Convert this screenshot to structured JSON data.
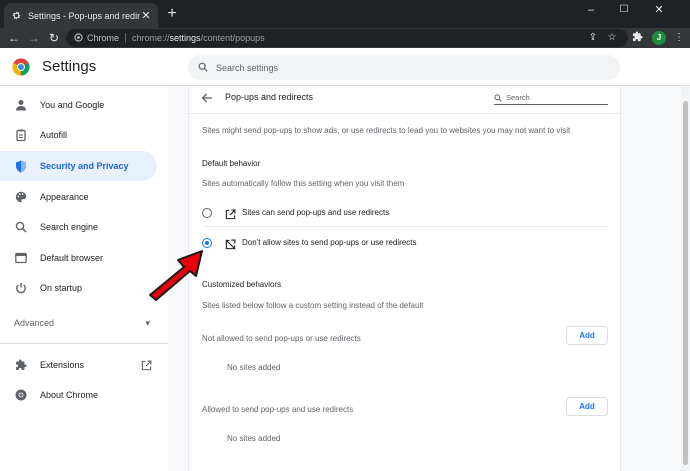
{
  "browser": {
    "tab_title": "Settings - Pop-ups and redirects",
    "omnibox_chrome_label": "Chrome",
    "url_prefix": "chrome://",
    "url_highlight": "settings",
    "url_suffix": "/content/popups",
    "profile_initial": "J"
  },
  "header": {
    "title": "Settings",
    "search_placeholder": "Search settings"
  },
  "sidebar": {
    "items": [
      {
        "label": "You and Google",
        "icon": "person-icon"
      },
      {
        "label": "Autofill",
        "icon": "clipboard-icon"
      },
      {
        "label": "Security and Privacy",
        "icon": "shield-icon",
        "active": true
      },
      {
        "label": "Appearance",
        "icon": "palette-icon"
      },
      {
        "label": "Search engine",
        "icon": "search-icon"
      },
      {
        "label": "Default browser",
        "icon": "browser-icon"
      },
      {
        "label": "On startup",
        "icon": "power-icon"
      }
    ],
    "advanced_label": "Advanced",
    "extensions_label": "Extensions",
    "about_label": "About Chrome"
  },
  "page": {
    "title": "Pop-ups and redirects",
    "search_placeholder": "Search",
    "description": "Sites might send pop-ups to show ads, or use redirects to lead you to websites you may not want to visit",
    "default_behavior_heading": "Default behavior",
    "default_behavior_sub": "Sites automatically follow this setting when you visit them",
    "option_allow": "Sites can send pop-ups and use redirects",
    "option_block": "Don't allow sites to send pop-ups or use redirects",
    "selected_option": "block",
    "customized_heading": "Customized behaviors",
    "customized_sub": "Sites listed below follow a custom setting instead of the default",
    "not_allowed_label": "Not allowed to send pop-ups or use redirects",
    "allowed_label": "Allowed to send pop-ups and use redirects",
    "add_label": "Add",
    "no_sites": "No sites added"
  },
  "colors": {
    "accent": "#1a73e8",
    "active_bg": "#e8f0fe",
    "annotation_arrow": "#e8000b"
  }
}
